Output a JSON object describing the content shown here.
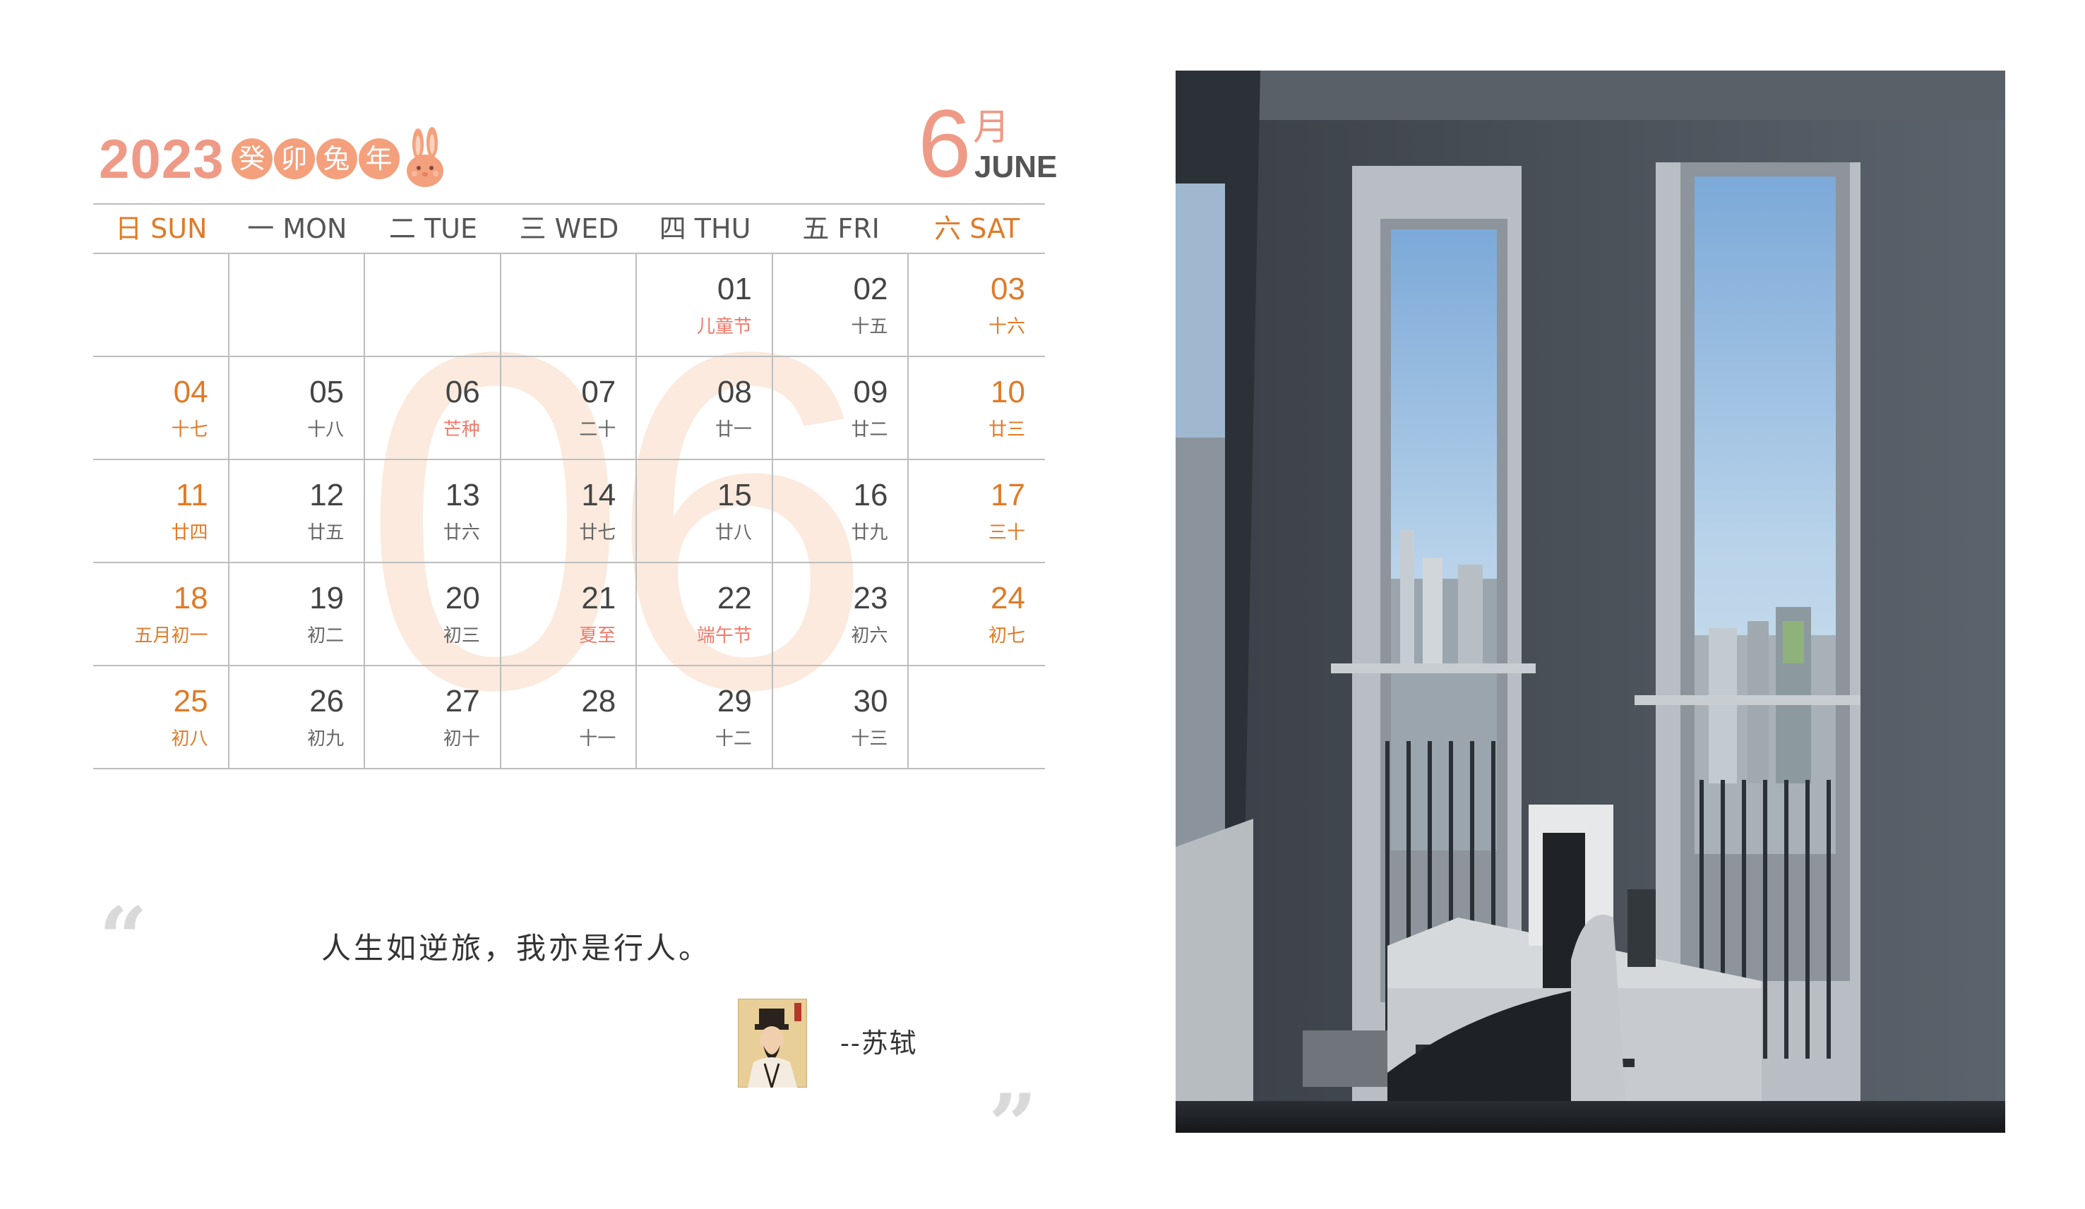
{
  "header": {
    "year": "2023",
    "zodiac_chars": [
      "癸",
      "卯",
      "兔",
      "年"
    ],
    "month_number": "6",
    "month_cn": "月",
    "month_en": "JUNE"
  },
  "watermark": "06",
  "weekdays": [
    {
      "label": "日 SUN",
      "weekend": true
    },
    {
      "label": "一 MON",
      "weekend": false
    },
    {
      "label": "二 TUE",
      "weekend": false
    },
    {
      "label": "三 WED",
      "weekend": false
    },
    {
      "label": "四 THU",
      "weekend": false
    },
    {
      "label": "五 FRI",
      "weekend": false
    },
    {
      "label": "六 SAT",
      "weekend": true
    }
  ],
  "weeks": [
    [
      null,
      null,
      null,
      null,
      {
        "day": "01",
        "lunar": "儿童节",
        "festival": true
      },
      {
        "day": "02",
        "lunar": "十五"
      },
      {
        "day": "03",
        "lunar": "十六"
      }
    ],
    [
      {
        "day": "04",
        "lunar": "十七"
      },
      {
        "day": "05",
        "lunar": "十八"
      },
      {
        "day": "06",
        "lunar": "芒种",
        "festival": true
      },
      {
        "day": "07",
        "lunar": "二十"
      },
      {
        "day": "08",
        "lunar": "廿一"
      },
      {
        "day": "09",
        "lunar": "廿二"
      },
      {
        "day": "10",
        "lunar": "廿三"
      }
    ],
    [
      {
        "day": "11",
        "lunar": "廿四"
      },
      {
        "day": "12",
        "lunar": "廿五"
      },
      {
        "day": "13",
        "lunar": "廿六"
      },
      {
        "day": "14",
        "lunar": "廿七"
      },
      {
        "day": "15",
        "lunar": "廿八"
      },
      {
        "day": "16",
        "lunar": "廿九"
      },
      {
        "day": "17",
        "lunar": "三十"
      }
    ],
    [
      {
        "day": "18",
        "lunar": "五月初一"
      },
      {
        "day": "19",
        "lunar": "初二"
      },
      {
        "day": "20",
        "lunar": "初三"
      },
      {
        "day": "21",
        "lunar": "夏至",
        "festival": true
      },
      {
        "day": "22",
        "lunar": "端午节",
        "festival": true
      },
      {
        "day": "23",
        "lunar": "初六"
      },
      {
        "day": "24",
        "lunar": "初七"
      }
    ],
    [
      {
        "day": "25",
        "lunar": "初八"
      },
      {
        "day": "26",
        "lunar": "初九"
      },
      {
        "day": "27",
        "lunar": "初十"
      },
      {
        "day": "28",
        "lunar": "十一"
      },
      {
        "day": "29",
        "lunar": "十二"
      },
      {
        "day": "30",
        "lunar": "十三"
      },
      null
    ]
  ],
  "quote": {
    "open_mark": "“",
    "text": "人生如逆旅，我亦是行人。",
    "author": "--苏轼",
    "close_mark": "”"
  },
  "colors": {
    "accent": "#ef9a86",
    "weekend": "#e07a27",
    "festival": "#ef7a6a",
    "zodiac_circle": "#f4a07c",
    "watermark": "#fbe7d8",
    "grid_line": "#bdbdbd"
  }
}
